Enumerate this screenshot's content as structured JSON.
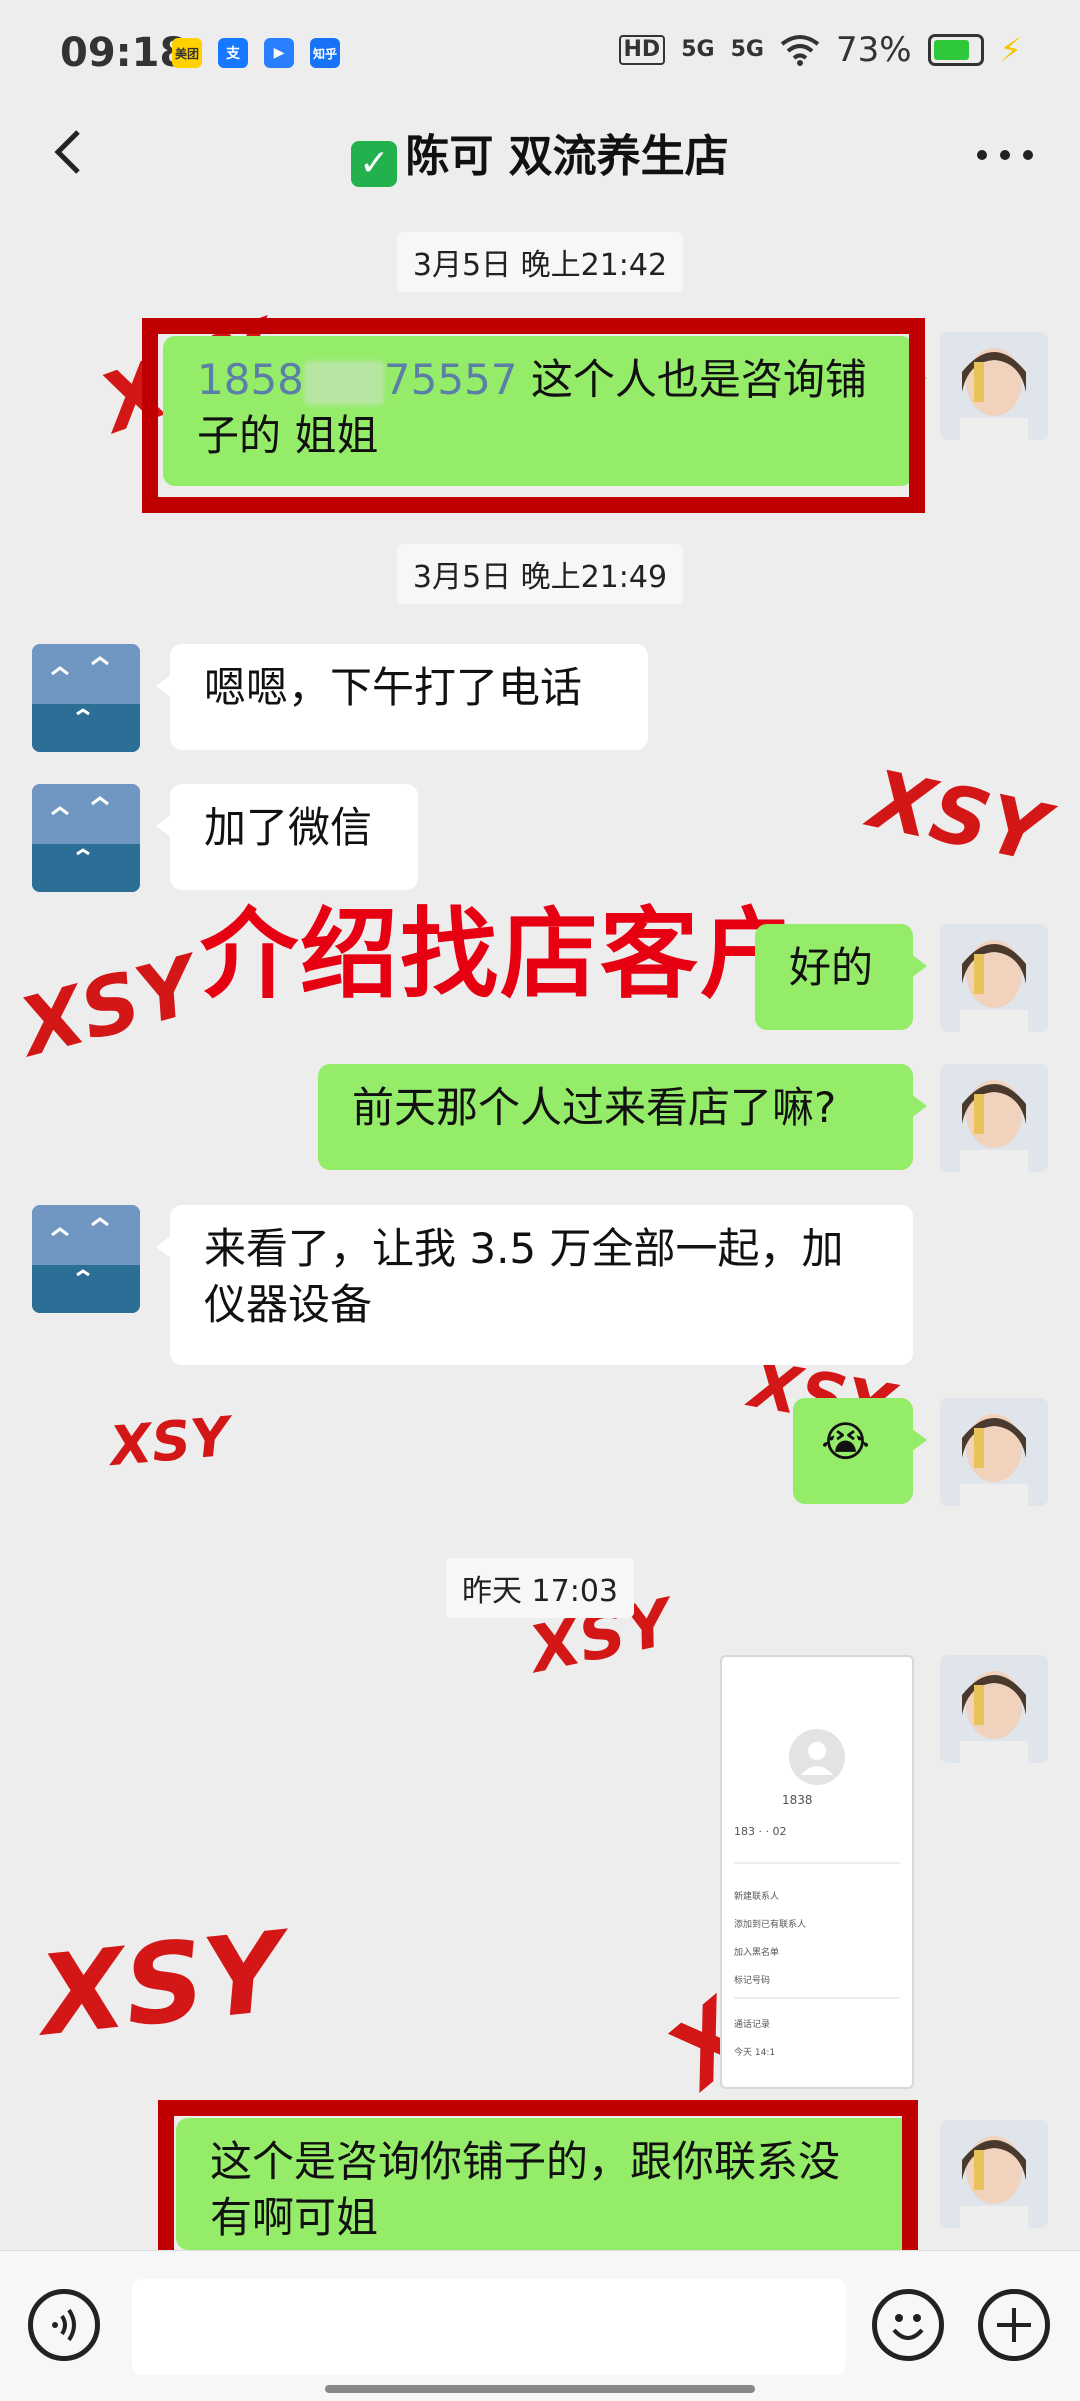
{
  "status_bar": {
    "time": "09:18",
    "apps": [
      {
        "name": "meituan-icon",
        "label": "美团",
        "color": "#ffd100"
      },
      {
        "name": "alipay-icon",
        "label": "支",
        "color": "#1677ff"
      },
      {
        "name": "app-icon",
        "label": "▶",
        "color": "#2a7fff"
      },
      {
        "name": "zhihu-icon",
        "label": "知乎",
        "color": "#1772f6"
      }
    ],
    "hd": "HD",
    "network1": "5G",
    "network2": "5G",
    "battery": "73%",
    "battery_level": 0.73
  },
  "chat": {
    "title": "陈可 双流养生店"
  },
  "messages": {
    "ts1": "3月5日 晚上21:42",
    "m1_phone_a": "1858",
    "m1_phone_b": "75557",
    "m1_text": " 这个人也是咨询铺子的 姐姐",
    "ts2": "3月5日 晚上21:49",
    "m2": "嗯嗯，下午打了电话",
    "m3": "加了微信",
    "m4": "好的",
    "m5": "前天那个人过来看店了嘛?",
    "m6": "来看了，让我 3.5 万全部一起，加仪器设备",
    "m7": "😭",
    "ts3": "昨天 17:03",
    "m9": "这个是咨询你铺子的，跟你联系没有啊可姐"
  },
  "overlay_text": "介绍找店客户",
  "watermark": "XSY",
  "screenshot": {
    "number": "1838",
    "number2": "183",
    "number3": "02",
    "menu": [
      "新建联系人",
      "添加到已有联系人",
      "加入黑名单",
      "标记号码"
    ],
    "recent_label": "通话记录",
    "recent": "今天 14:1"
  }
}
